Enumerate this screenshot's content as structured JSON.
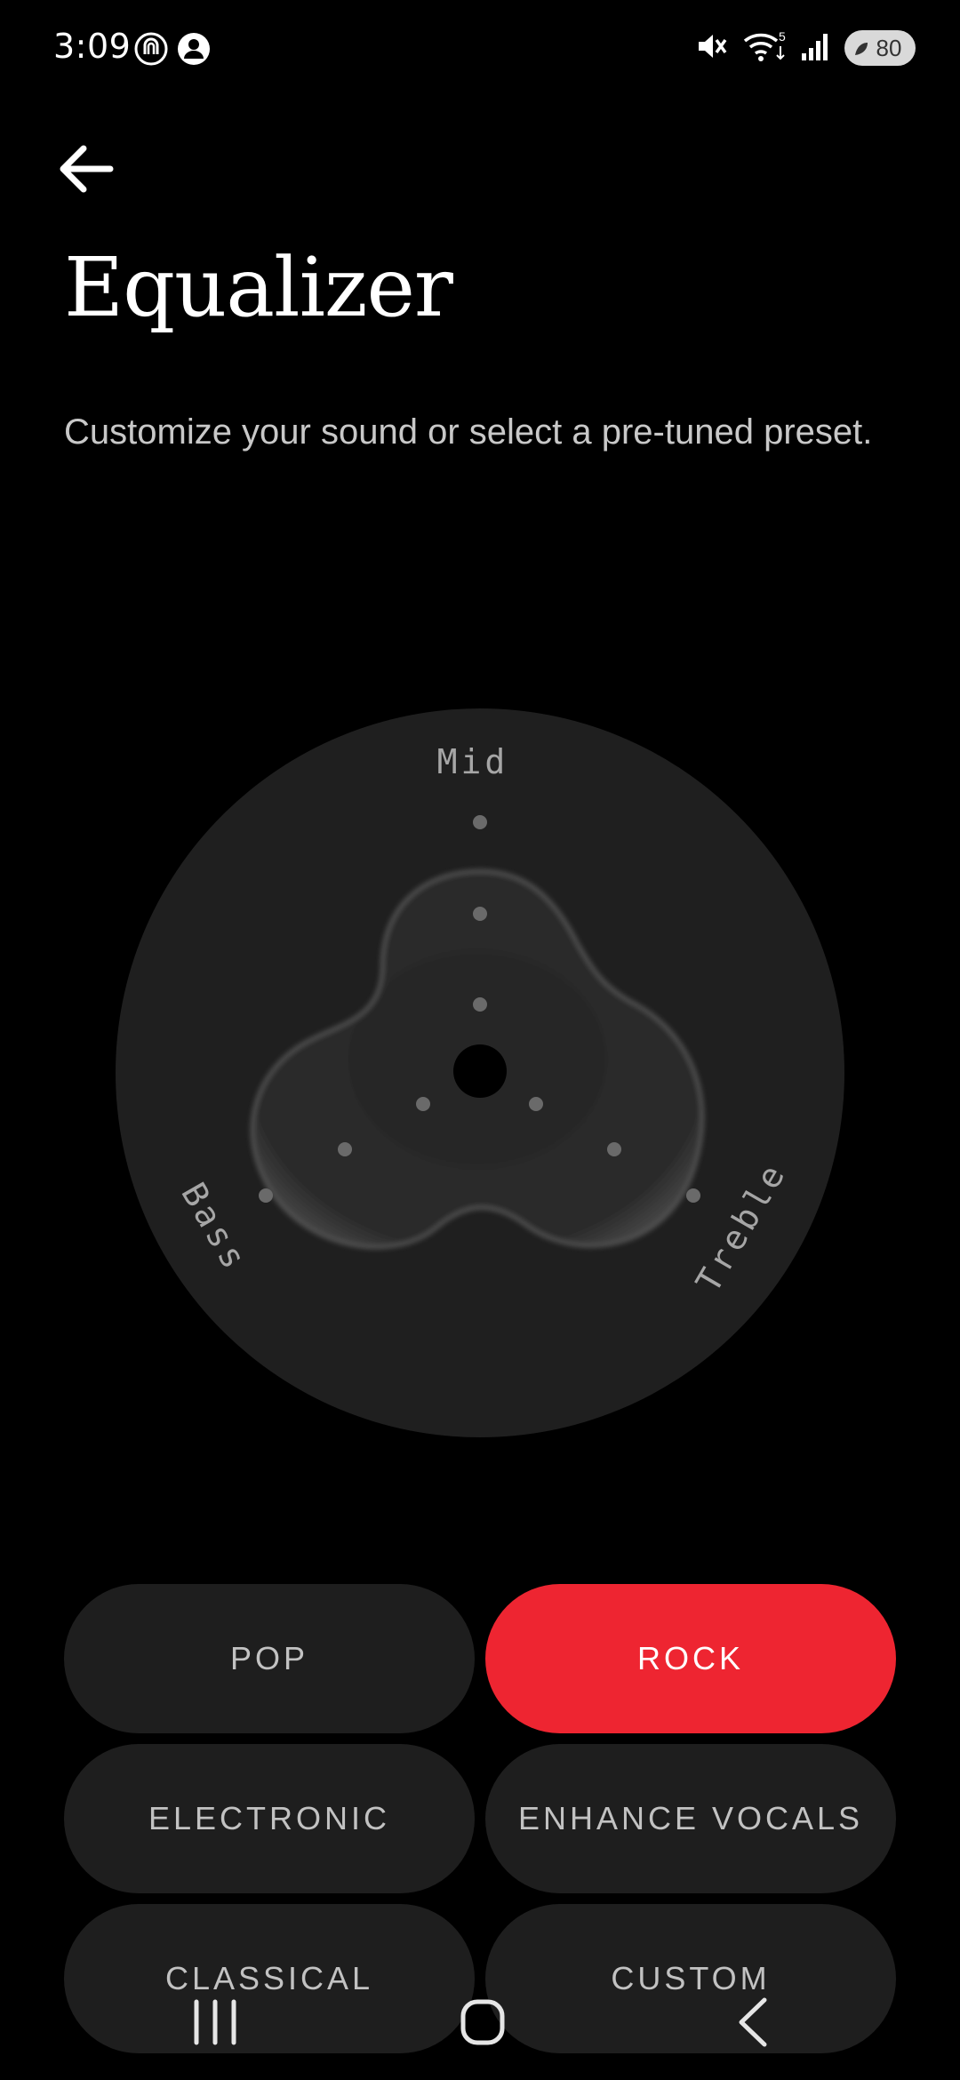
{
  "status_bar": {
    "time": "3:09",
    "battery_level": "80",
    "icons": [
      "nfc-icon",
      "account-icon",
      "mute-icon",
      "wifi-icon",
      "signal-icon",
      "battery-icon"
    ]
  },
  "header": {
    "back_icon": "arrow-left-icon",
    "title": "Equalizer",
    "subtitle": "Customize your sound or select a pre-tuned preset."
  },
  "equalizer": {
    "labels": {
      "mid": "Mid",
      "bass": "Bass",
      "treble": "Treble"
    },
    "colors": {
      "dial": "#1f1f1f",
      "blob": "#2e2e2e",
      "dot": "#6a6a6a"
    }
  },
  "presets": [
    {
      "label": "POP",
      "active": false
    },
    {
      "label": "ROCK",
      "active": true
    },
    {
      "label": "ELECTRONIC",
      "active": false
    },
    {
      "label": "ENHANCE VOCALS",
      "active": false
    },
    {
      "label": "CLASSICAL",
      "active": false
    },
    {
      "label": "CUSTOM",
      "active": false
    }
  ],
  "accent_color": "#ee2531",
  "nav_bar": {
    "icons": [
      "recents-icon",
      "home-icon",
      "back-icon"
    ]
  }
}
